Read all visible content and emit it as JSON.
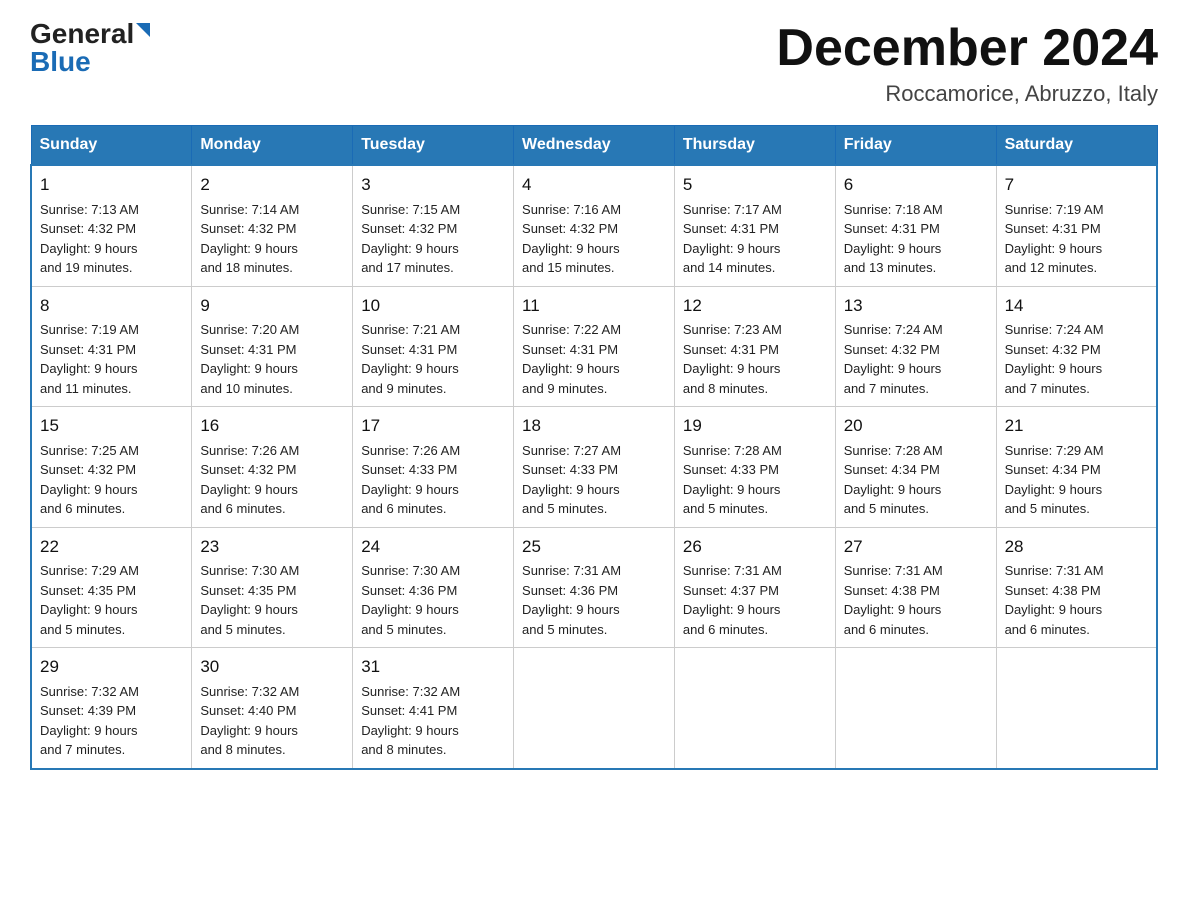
{
  "logo": {
    "general": "General",
    "blue": "Blue"
  },
  "title": "December 2024",
  "location": "Roccamorice, Abruzzo, Italy",
  "days_of_week": [
    "Sunday",
    "Monday",
    "Tuesday",
    "Wednesday",
    "Thursday",
    "Friday",
    "Saturday"
  ],
  "weeks": [
    [
      {
        "day": "1",
        "sunrise": "7:13 AM",
        "sunset": "4:32 PM",
        "daylight": "9 hours and 19 minutes."
      },
      {
        "day": "2",
        "sunrise": "7:14 AM",
        "sunset": "4:32 PM",
        "daylight": "9 hours and 18 minutes."
      },
      {
        "day": "3",
        "sunrise": "7:15 AM",
        "sunset": "4:32 PM",
        "daylight": "9 hours and 17 minutes."
      },
      {
        "day": "4",
        "sunrise": "7:16 AM",
        "sunset": "4:32 PM",
        "daylight": "9 hours and 15 minutes."
      },
      {
        "day": "5",
        "sunrise": "7:17 AM",
        "sunset": "4:31 PM",
        "daylight": "9 hours and 14 minutes."
      },
      {
        "day": "6",
        "sunrise": "7:18 AM",
        "sunset": "4:31 PM",
        "daylight": "9 hours and 13 minutes."
      },
      {
        "day": "7",
        "sunrise": "7:19 AM",
        "sunset": "4:31 PM",
        "daylight": "9 hours and 12 minutes."
      }
    ],
    [
      {
        "day": "8",
        "sunrise": "7:19 AM",
        "sunset": "4:31 PM",
        "daylight": "9 hours and 11 minutes."
      },
      {
        "day": "9",
        "sunrise": "7:20 AM",
        "sunset": "4:31 PM",
        "daylight": "9 hours and 10 minutes."
      },
      {
        "day": "10",
        "sunrise": "7:21 AM",
        "sunset": "4:31 PM",
        "daylight": "9 hours and 9 minutes."
      },
      {
        "day": "11",
        "sunrise": "7:22 AM",
        "sunset": "4:31 PM",
        "daylight": "9 hours and 9 minutes."
      },
      {
        "day": "12",
        "sunrise": "7:23 AM",
        "sunset": "4:31 PM",
        "daylight": "9 hours and 8 minutes."
      },
      {
        "day": "13",
        "sunrise": "7:24 AM",
        "sunset": "4:32 PM",
        "daylight": "9 hours and 7 minutes."
      },
      {
        "day": "14",
        "sunrise": "7:24 AM",
        "sunset": "4:32 PM",
        "daylight": "9 hours and 7 minutes."
      }
    ],
    [
      {
        "day": "15",
        "sunrise": "7:25 AM",
        "sunset": "4:32 PM",
        "daylight": "9 hours and 6 minutes."
      },
      {
        "day": "16",
        "sunrise": "7:26 AM",
        "sunset": "4:32 PM",
        "daylight": "9 hours and 6 minutes."
      },
      {
        "day": "17",
        "sunrise": "7:26 AM",
        "sunset": "4:33 PM",
        "daylight": "9 hours and 6 minutes."
      },
      {
        "day": "18",
        "sunrise": "7:27 AM",
        "sunset": "4:33 PM",
        "daylight": "9 hours and 5 minutes."
      },
      {
        "day": "19",
        "sunrise": "7:28 AM",
        "sunset": "4:33 PM",
        "daylight": "9 hours and 5 minutes."
      },
      {
        "day": "20",
        "sunrise": "7:28 AM",
        "sunset": "4:34 PM",
        "daylight": "9 hours and 5 minutes."
      },
      {
        "day": "21",
        "sunrise": "7:29 AM",
        "sunset": "4:34 PM",
        "daylight": "9 hours and 5 minutes."
      }
    ],
    [
      {
        "day": "22",
        "sunrise": "7:29 AM",
        "sunset": "4:35 PM",
        "daylight": "9 hours and 5 minutes."
      },
      {
        "day": "23",
        "sunrise": "7:30 AM",
        "sunset": "4:35 PM",
        "daylight": "9 hours and 5 minutes."
      },
      {
        "day": "24",
        "sunrise": "7:30 AM",
        "sunset": "4:36 PM",
        "daylight": "9 hours and 5 minutes."
      },
      {
        "day": "25",
        "sunrise": "7:31 AM",
        "sunset": "4:36 PM",
        "daylight": "9 hours and 5 minutes."
      },
      {
        "day": "26",
        "sunrise": "7:31 AM",
        "sunset": "4:37 PM",
        "daylight": "9 hours and 6 minutes."
      },
      {
        "day": "27",
        "sunrise": "7:31 AM",
        "sunset": "4:38 PM",
        "daylight": "9 hours and 6 minutes."
      },
      {
        "day": "28",
        "sunrise": "7:31 AM",
        "sunset": "4:38 PM",
        "daylight": "9 hours and 6 minutes."
      }
    ],
    [
      {
        "day": "29",
        "sunrise": "7:32 AM",
        "sunset": "4:39 PM",
        "daylight": "9 hours and 7 minutes."
      },
      {
        "day": "30",
        "sunrise": "7:32 AM",
        "sunset": "4:40 PM",
        "daylight": "9 hours and 8 minutes."
      },
      {
        "day": "31",
        "sunrise": "7:32 AM",
        "sunset": "4:41 PM",
        "daylight": "9 hours and 8 minutes."
      },
      null,
      null,
      null,
      null
    ]
  ],
  "labels": {
    "sunrise": "Sunrise:",
    "sunset": "Sunset:",
    "daylight": "Daylight:"
  }
}
